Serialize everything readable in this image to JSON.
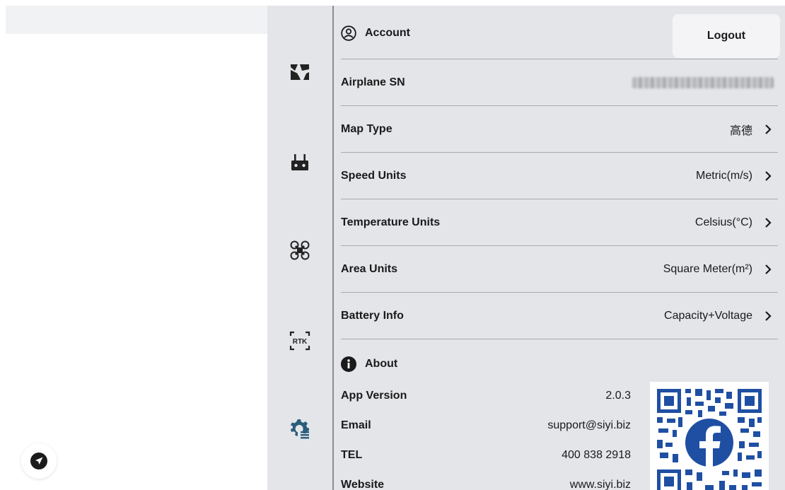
{
  "account": {
    "title": "Account",
    "logout_label": "Logout"
  },
  "settings_rows": [
    {
      "label": "Airplane SN",
      "value": "",
      "blurred": true
    },
    {
      "label": "Map Type",
      "value": "高德"
    },
    {
      "label": "Speed Units",
      "value": "Metric(m/s)"
    },
    {
      "label": "Temperature Units",
      "value": "Celsius(°C)"
    },
    {
      "label": "Area Units",
      "value": "Square Meter(m²)"
    },
    {
      "label": "Battery Info",
      "value": "Capacity+Voltage"
    }
  ],
  "about": {
    "title": "About",
    "rows": [
      {
        "label": "App Version",
        "value": "2.0.3"
      },
      {
        "label": "Email",
        "value": "support@siyi.biz"
      },
      {
        "label": "TEL",
        "value": "400 838 2918"
      },
      {
        "label": "Website",
        "value": "www.siyi.biz"
      }
    ]
  },
  "rail": {
    "rtk_label": "RTK",
    "icons": [
      "camera-settings-icon",
      "remote-controller-icon",
      "drone-icon",
      "rtk-icon",
      "general-settings-icon"
    ]
  },
  "colors": {
    "panel_bg": "#e4e5e9",
    "divider": "#a9aaae",
    "text": "#1a1a1a",
    "rail_icon": "#222222",
    "gear_icon": "#2a5d7c"
  }
}
